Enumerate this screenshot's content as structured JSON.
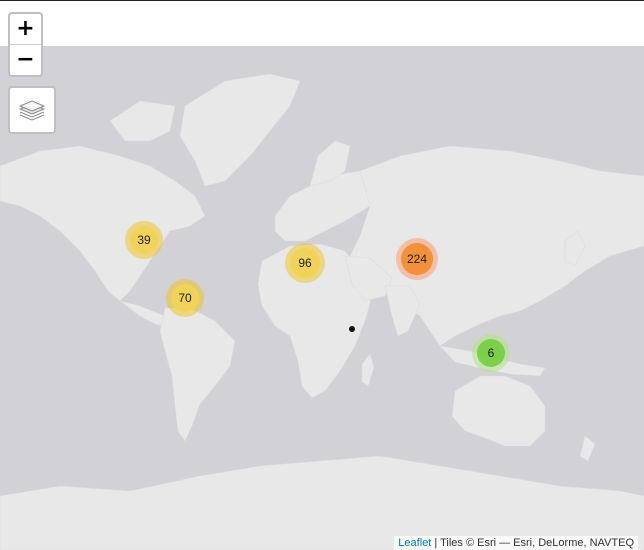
{
  "controls": {
    "zoom_in_label": "+",
    "zoom_out_label": "−",
    "layers_icon": "layers-icon"
  },
  "clusters": [
    {
      "count": "39",
      "color": "yellow"
    },
    {
      "count": "70",
      "color": "yellow"
    },
    {
      "count": "96",
      "color": "yellow"
    },
    {
      "count": "224",
      "color": "orange"
    },
    {
      "count": "6",
      "color": "green"
    }
  ],
  "attribution": {
    "link_text": "Leaflet",
    "text": " | Tiles © Esri — Esri, DeLorme, NAVTEQ"
  },
  "colors": {
    "ocean": "#d2d2d6",
    "land": "#e8e8e8",
    "cluster_yellow": "#f1d357",
    "cluster_orange": "#fd9c73",
    "cluster_green": "#6ecc39",
    "link": "#0078A8"
  }
}
